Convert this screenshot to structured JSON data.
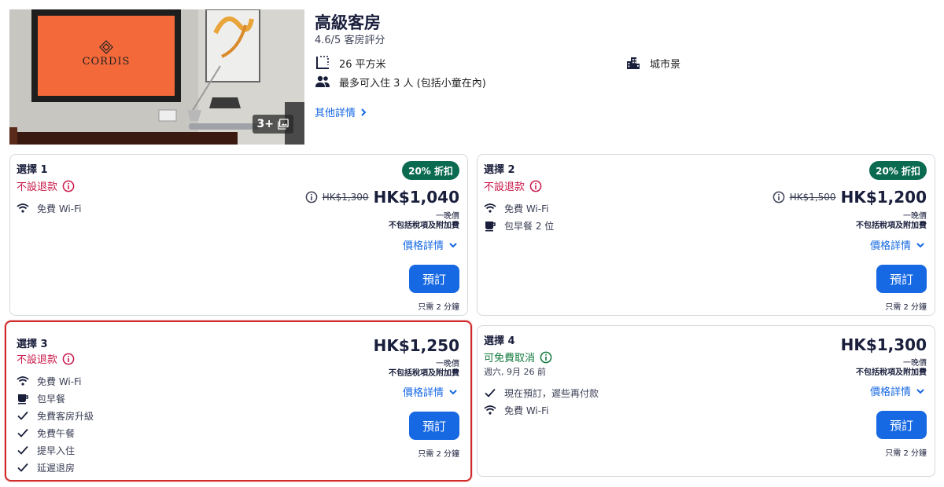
{
  "header": {
    "photo_count": "3+",
    "photo_logo_text": "CORDIS",
    "room_name": "高級客房",
    "rating": "4.6/5 客房評分",
    "features": {
      "size": "26 平方米",
      "occupancy": "最多可入住 3 人 (包括小童在內)",
      "view": "城市景"
    },
    "more_details": "其他詳情"
  },
  "colors": {
    "link": "#1668e3",
    "button": "#1668e3",
    "non_refundable": "#c9184a",
    "free_cancel": "#127a3c",
    "badge": "#0b6b50",
    "selected_border": "#d12a2a"
  },
  "options": [
    {
      "title": "選擇 1",
      "refund": "不設退款",
      "badge": "20% 折扣",
      "old_price": "HK$1,300",
      "price": "HK$1,040",
      "amenities": [
        "免費 Wi-Fi"
      ],
      "per_night": "一晚價",
      "tax_note": "不包括稅項及附加費",
      "price_details": "價格詳情",
      "reserve": "預訂",
      "time_note": "只需 2 分鐘"
    },
    {
      "title": "選擇 2",
      "refund": "不設退款",
      "badge": "20% 折扣",
      "old_price": "HK$1,500",
      "price": "HK$1,200",
      "amenities": [
        "免費 Wi-Fi",
        "包早餐 2 位"
      ],
      "per_night": "一晚價",
      "tax_note": "不包括稅項及附加費",
      "price_details": "價格詳情",
      "reserve": "預訂",
      "time_note": "只需 2 分鐘"
    },
    {
      "title": "選擇 3",
      "refund": "不設退款",
      "price": "HK$1,250",
      "amenities": [
        "免費 Wi-Fi",
        "包早餐",
        "免費客房升級",
        "免費午餐",
        "提早入住",
        "延遲退房"
      ],
      "per_night": "一晚價",
      "tax_note": "不包括稅項及附加費",
      "price_details": "價格詳情",
      "reserve": "預訂",
      "time_note": "只需 2 分鐘"
    },
    {
      "title": "選擇 4",
      "refund": "可免費取消",
      "refund_until": "週六, 9月 26 前",
      "price": "HK$1,300",
      "amenities": [
        "現在預訂，遲些再付款",
        "免費 Wi-Fi"
      ],
      "per_night": "一晚價",
      "tax_note": "不包括稅項及附加費",
      "price_details": "價格詳情",
      "reserve": "預訂",
      "time_note": "只需 2 分鐘"
    }
  ]
}
